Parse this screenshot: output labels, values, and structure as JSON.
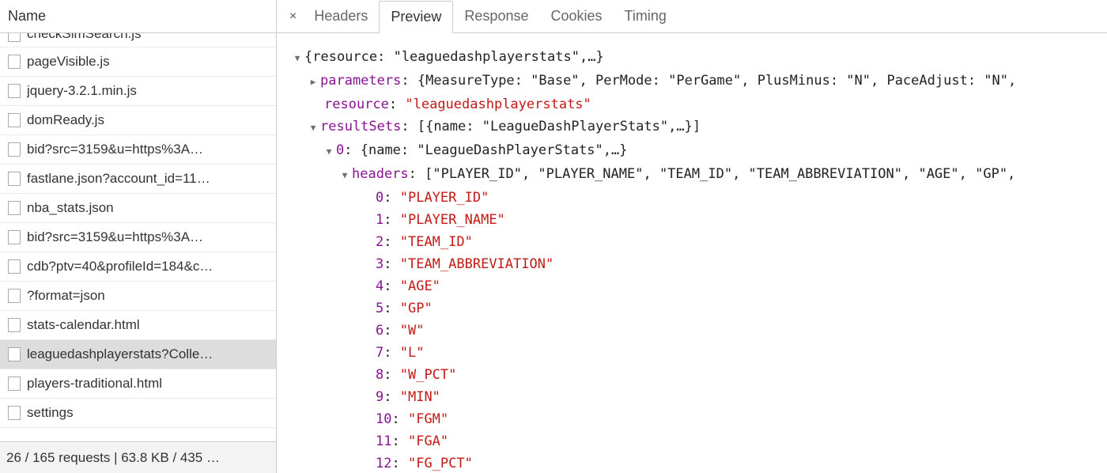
{
  "left": {
    "header": "Name",
    "files": [
      {
        "label": "checkSimSearch.js",
        "cutoff": true
      },
      {
        "label": "pageVisible.js"
      },
      {
        "label": "jquery-3.2.1.min.js"
      },
      {
        "label": "domReady.js"
      },
      {
        "label": "bid?src=3159&u=https%3A…"
      },
      {
        "label": "fastlane.json?account_id=11…"
      },
      {
        "label": "nba_stats.json"
      },
      {
        "label": "bid?src=3159&u=https%3A…"
      },
      {
        "label": "cdb?ptv=40&profileId=184&c…"
      },
      {
        "label": "?format=json"
      },
      {
        "label": "stats-calendar.html"
      },
      {
        "label": "leaguedashplayerstats?Colle…",
        "selected": true
      },
      {
        "label": "players-traditional.html"
      },
      {
        "label": "settings"
      }
    ],
    "footer": "26 / 165 requests | 63.8 KB / 435 …"
  },
  "tabs": {
    "items": [
      "Headers",
      "Preview",
      "Response",
      "Cookies",
      "Timing"
    ],
    "activeIndex": 1,
    "close": "×"
  },
  "preview": {
    "topSummary": "{resource: \"leaguedashplayerstats\",…}",
    "paramSummary": "{MeasureType: \"Base\", PerMode: \"PerGame\", PlusMinus: \"N\", PaceAdjust: \"N\",",
    "resourceKey": "resource",
    "resourceVal": "\"leaguedashplayerstats\"",
    "parametersKey": "parameters",
    "resultSetsKey": "resultSets",
    "resultSetsSummary": "[{name: \"LeagueDashPlayerStats\",…}]",
    "zeroKey": "0",
    "zeroSummary": "{name: \"LeagueDashPlayerStats\",…}",
    "headersKey": "headers",
    "headersSummary": "[\"PLAYER_ID\", \"PLAYER_NAME\", \"TEAM_ID\", \"TEAM_ABBREVIATION\", \"AGE\", \"GP\",",
    "headerItems": [
      "\"PLAYER_ID\"",
      "\"PLAYER_NAME\"",
      "\"TEAM_ID\"",
      "\"TEAM_ABBREVIATION\"",
      "\"AGE\"",
      "\"GP\"",
      "\"W\"",
      "\"L\"",
      "\"W_PCT\"",
      "\"MIN\"",
      "\"FGM\"",
      "\"FGA\"",
      "\"FG_PCT\""
    ]
  }
}
